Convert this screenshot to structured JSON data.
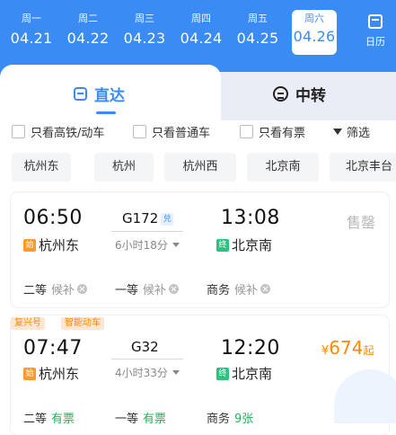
{
  "dates": [
    {
      "weekday": "周一",
      "date": "04.21"
    },
    {
      "weekday": "周二",
      "date": "04.22"
    },
    {
      "weekday": "周三",
      "date": "04.23"
    },
    {
      "weekday": "周四",
      "date": "04.24"
    },
    {
      "weekday": "周五",
      "date": "04.25"
    },
    {
      "weekday": "周六",
      "date": "04.26"
    }
  ],
  "calendar_label": "日历",
  "modes": {
    "direct": "直达",
    "transfer": "中转"
  },
  "filters": {
    "hs": "只看高铁/动车",
    "normal": "只看普通车",
    "has_ticket": "只看有票",
    "filter": "筛选"
  },
  "stations": [
    "杭州东",
    "杭州",
    "杭州西",
    "北京南",
    "北京丰台"
  ],
  "trains": [
    {
      "depart_time": "06:50",
      "train_no": "G172",
      "exchange": "兑",
      "duration": "6小时18分",
      "arrive_time": "13:08",
      "start_badge": "始",
      "from": "杭州东",
      "end_badge": "终",
      "to": "北京南",
      "status": "售罄",
      "seats": [
        {
          "class": "二等",
          "state": "候补"
        },
        {
          "class": "一等",
          "state": "候补"
        },
        {
          "class": "商务",
          "state": "候补"
        }
      ]
    },
    {
      "tags": [
        "复兴号",
        "智能动车"
      ],
      "depart_time": "07:47",
      "train_no": "G32",
      "duration": "4小时33分",
      "arrive_time": "12:20",
      "start_badge": "始",
      "from": "杭州东",
      "end_badge": "终",
      "to": "北京南",
      "price_symbol": "¥",
      "price": "674",
      "price_suffix": "起",
      "seats": [
        {
          "class": "二等",
          "state": "有票"
        },
        {
          "class": "一等",
          "state": "有票"
        },
        {
          "class": "商务",
          "state": "9张"
        }
      ]
    }
  ]
}
